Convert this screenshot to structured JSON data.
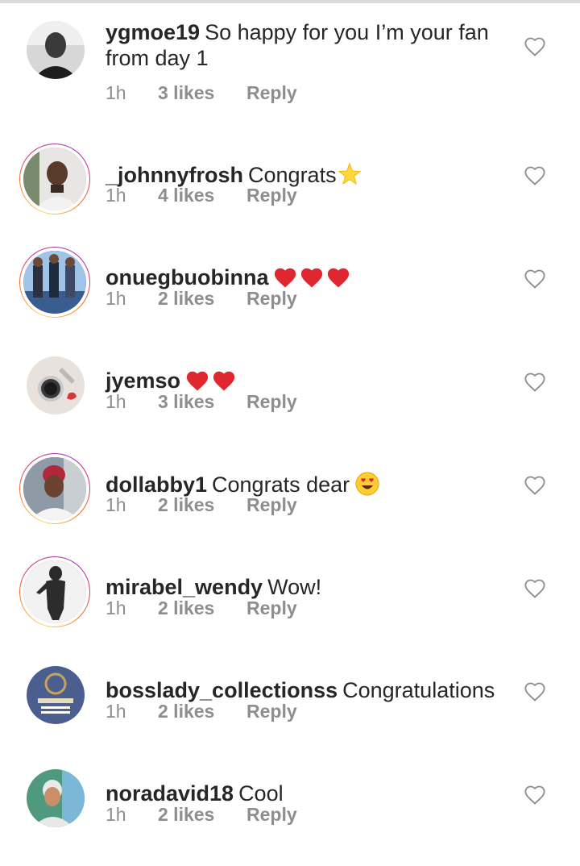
{
  "comments": [
    {
      "username": "ygmoe19",
      "text": "So happy for you I’m your fan from day 1",
      "time": "1h",
      "likes": "3 likes",
      "reply": "Reply",
      "emoji": []
    },
    {
      "username": "_johnnyfrosh",
      "text": "Congrats",
      "time": "1h",
      "likes": "4 likes",
      "reply": "Reply",
      "emoji": [
        "star"
      ]
    },
    {
      "username": "onuegbuobinna",
      "text": "",
      "time": "1h",
      "likes": "2 likes",
      "reply": "Reply",
      "emoji": [
        "red-heart",
        "red-heart",
        "red-heart"
      ]
    },
    {
      "username": "jyemso",
      "text": "",
      "time": "1h",
      "likes": "3 likes",
      "reply": "Reply",
      "emoji": [
        "red-heart",
        "red-heart"
      ]
    },
    {
      "username": "dollabby1",
      "text": "Congrats dear",
      "time": "1h",
      "likes": "2 likes",
      "reply": "Reply",
      "emoji": [
        "heart-eyes-face"
      ]
    },
    {
      "username": "mirabel_wendy",
      "text": "Wow!",
      "time": "1h",
      "likes": "2 likes",
      "reply": "Reply",
      "emoji": []
    },
    {
      "username": "bosslady_collectionss",
      "text": "Congratulations",
      "time": "1h",
      "likes": "2 likes",
      "reply": "Reply",
      "emoji": []
    },
    {
      "username": "noradavid18",
      "text": "Cool",
      "time": "1h",
      "likes": "2 likes",
      "reply": "Reply",
      "emoji": []
    }
  ],
  "colors": {
    "text": "#262626",
    "meta": "#8e8e8e",
    "heart_emoji": "#e0262f",
    "divider": "#dbdbdb"
  },
  "icons": {
    "like": "heart-outline-icon"
  }
}
